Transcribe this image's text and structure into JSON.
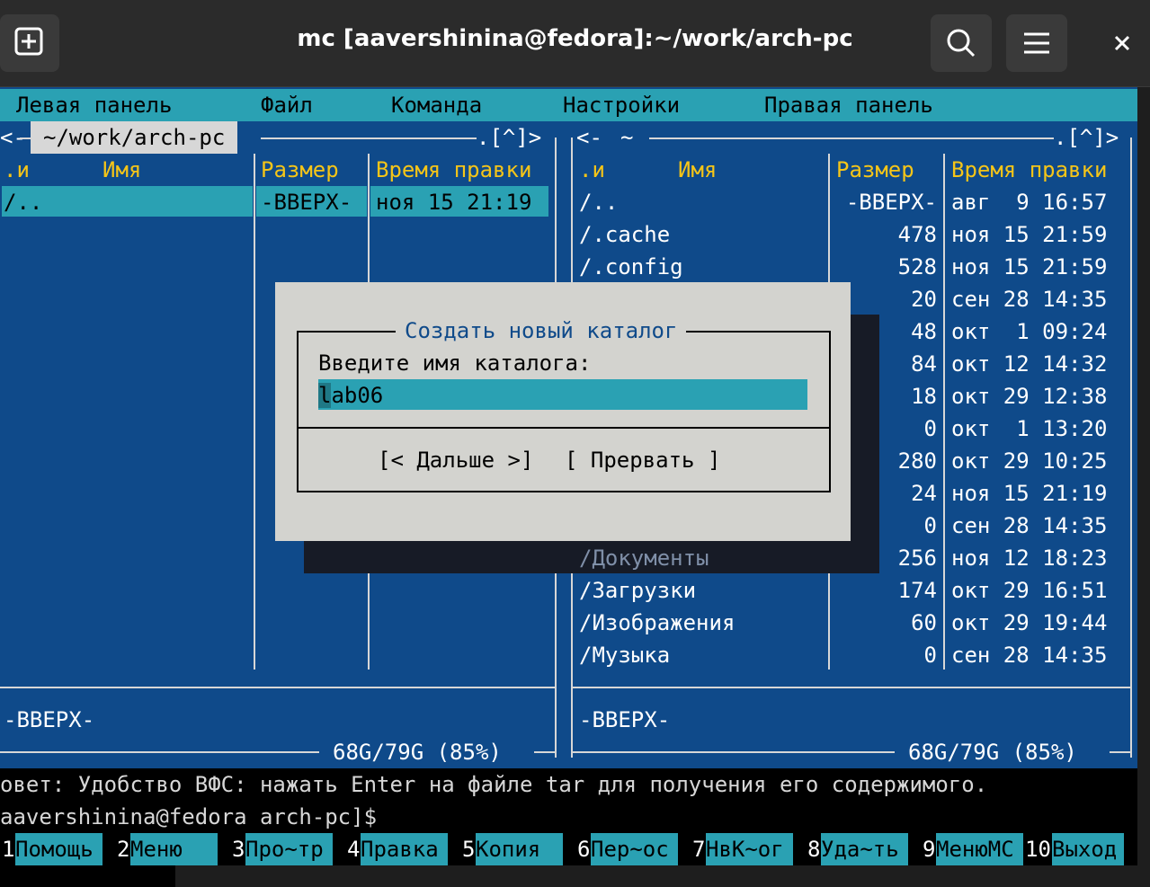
{
  "window": {
    "title": "mc [aavershinina@fedora]:~/work/arch-pc",
    "new_tab_icon": "plus-square-icon",
    "search_icon": "search-icon",
    "menu_icon": "hamburger-icon",
    "close_icon": "close-icon"
  },
  "menu": [
    "Левая панель",
    "Файл",
    "Команда",
    "Настройки",
    "Правая панель"
  ],
  "left_panel": {
    "path": "~/work/arch-pc",
    "corner": ".[^]>",
    "col_n": ".и",
    "col_name": "Имя",
    "col_size": "Размер",
    "col_time": "Время правки",
    "rows": [
      {
        "name": "/..",
        "size": "-ВВЕРХ-",
        "time": "ноя 15 21:19"
      }
    ],
    "status": "-ВВЕРХ-",
    "disk": "68G/79G (85%)"
  },
  "right_panel": {
    "path": "~",
    "corner": ".[^]>",
    "col_n": ".и",
    "col_name": "Имя",
    "col_size": "Размер",
    "col_time": "Время правки",
    "rows": [
      {
        "name": "/..",
        "size": "-ВВЕРХ-",
        "time": "авг  9 16:57"
      },
      {
        "name": "/.cache",
        "size": "478",
        "time": "ноя 15 21:59"
      },
      {
        "name": "/.config",
        "size": "528",
        "time": "ноя 15 21:59"
      },
      {
        "name": "",
        "size": "20",
        "time": "сен 28 14:35"
      },
      {
        "name": "",
        "size": "48",
        "time": "окт  1 09:24"
      },
      {
        "name": "",
        "size": "84",
        "time": "окт 12 14:32"
      },
      {
        "name": "",
        "size": "18",
        "time": "окт 29 12:38"
      },
      {
        "name": "",
        "size": "0",
        "time": "окт  1 13:20"
      },
      {
        "name": "",
        "size": "280",
        "time": "окт 29 10:25"
      },
      {
        "name": "",
        "size": "24",
        "time": "ноя 15 21:19"
      },
      {
        "name": "",
        "size": "0",
        "time": "сен 28 14:35"
      },
      {
        "name": "/Документы",
        "size": "256",
        "time": "ноя 12 18:23"
      },
      {
        "name": "/Загрузки",
        "size": "174",
        "time": "окт 29 16:51"
      },
      {
        "name": "/Изображения",
        "size": "60",
        "time": "окт 29 19:44"
      },
      {
        "name": "/Музыка",
        "size": "0",
        "time": "сен 28 14:35"
      }
    ],
    "status": "-ВВЕРХ-",
    "disk": "68G/79G (85%)"
  },
  "dialog": {
    "title": "Создать новый каталог",
    "prompt": "Введите имя каталога:",
    "value": "lab06",
    "ok_button": "[< Дальше >]",
    "cancel_button": "[ Прервать ]"
  },
  "hint": "овет: Удобство ВФС: нажать Enter на файле tar для получения его содержимого.",
  "prompt": "aavershinina@fedora arch-pc]$",
  "fkeys": [
    {
      "num": "1",
      "label": "Помощь"
    },
    {
      "num": "2",
      "label": "Меню"
    },
    {
      "num": "3",
      "label": "Про~тр"
    },
    {
      "num": "4",
      "label": "Правка"
    },
    {
      "num": "5",
      "label": "Копия"
    },
    {
      "num": "6",
      "label": "Пер~ос"
    },
    {
      "num": "7",
      "label": "НвК~ог"
    },
    {
      "num": "8",
      "label": "Уда~ть"
    },
    {
      "num": "9",
      "label": "МенюМС"
    },
    {
      "num": "10",
      "label": "Выход"
    }
  ],
  "colors": {
    "panel_bg": "#0f4a8a",
    "accent": "#2aa1b3",
    "header_text": "#f5c518",
    "dialog_bg": "#d3d3cf"
  }
}
